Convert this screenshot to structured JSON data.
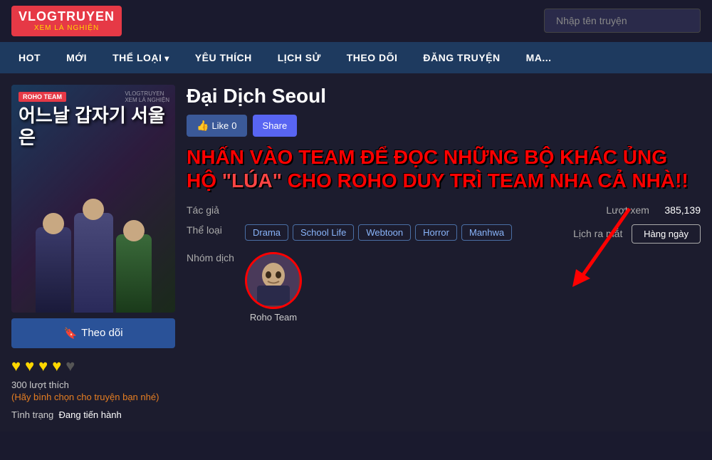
{
  "site": {
    "logo_main": "VLOGTRUYEN",
    "logo_sub": "XEM LÀ NGHIỆN",
    "search_placeholder": "Nhập tên truyện"
  },
  "nav": {
    "items": [
      {
        "label": "HOT",
        "has_arrow": false
      },
      {
        "label": "MỚI",
        "has_arrow": false
      },
      {
        "label": "THỂ LOẠI",
        "has_arrow": true
      },
      {
        "label": "YÊU THÍCH",
        "has_arrow": false
      },
      {
        "label": "LỊCH SỬ",
        "has_arrow": false
      },
      {
        "label": "THEO DÕI",
        "has_arrow": false
      },
      {
        "label": "ĐĂNG TRUYỆN",
        "has_arrow": false
      },
      {
        "label": "MA...",
        "has_arrow": false
      }
    ]
  },
  "manga": {
    "title": "Đại Dịch Seoul",
    "cover_title_kr": "어느날 갑자기 서울은",
    "cover_badge": "ROHO TEAM",
    "cover_watermark": "VLOGTRUYEN\nXEM LÀ NGHIỆN",
    "like_count_label": "Like",
    "like_count": "0",
    "share_label": "Share",
    "follow_label": "Theo dõi",
    "hearts": [
      "♥",
      "♥",
      "♥",
      "♥"
    ],
    "like_total": "300 lượt thích",
    "like_note": "(Hãy bình chọn cho truyện bạn nhé)",
    "status_label": "Tình trạng",
    "status_value": "Đang tiến hành",
    "author_label": "Tác giả",
    "author_value": "",
    "genre_label": "Thể loại",
    "genres": [
      "Drama",
      "School Life",
      "Webtoon",
      "Horror",
      "Manhwa"
    ],
    "translator_label": "Nhóm dịch",
    "translator_name": "Roho Team",
    "views_label": "Lượt xem",
    "views_value": "385,139",
    "schedule_label": "Lịch ra mắt",
    "schedule_value": "Hàng ngày",
    "promo_line1": "NHẤN VÀO TEAM ĐỂ ĐỌC NHỮNG BỘ KHÁC ỦNG",
    "promo_line2": "HỘ \"LÚA\" CHO ROHO DUY TRÌ TEAM NHA CẢ NHÀ!!"
  }
}
